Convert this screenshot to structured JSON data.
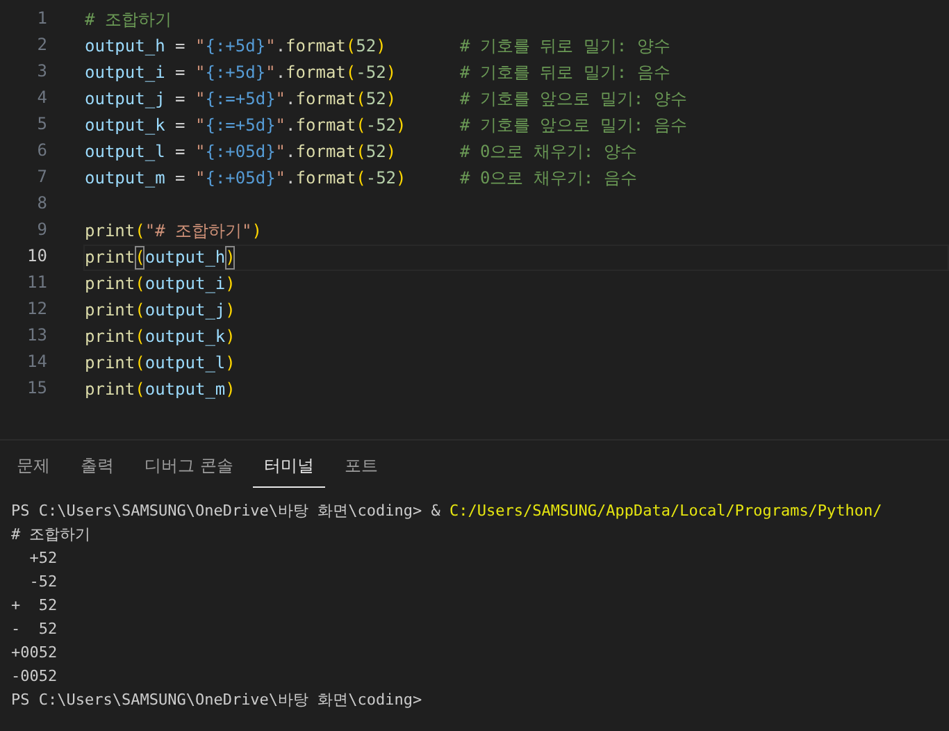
{
  "editor": {
    "lines": [
      {
        "number": "1",
        "current": false,
        "tokens": [
          {
            "kind": "comment",
            "text": "# 조합하기"
          }
        ]
      },
      {
        "number": "2",
        "current": false,
        "tokens": [
          {
            "kind": "var",
            "text": "output_h"
          },
          {
            "kind": "op",
            "text": " = "
          },
          {
            "kind": "str",
            "text": "\""
          },
          {
            "kind": "spec",
            "text": "{:+5d}"
          },
          {
            "kind": "str",
            "text": "\""
          },
          {
            "kind": "op",
            "text": "."
          },
          {
            "kind": "func",
            "text": "format"
          },
          {
            "kind": "paren",
            "text": "("
          },
          {
            "kind": "num",
            "text": "52"
          },
          {
            "kind": "paren",
            "text": ")"
          }
        ],
        "comment": "# 기호를 뒤로 밀기: 양수"
      },
      {
        "number": "3",
        "current": false,
        "tokens": [
          {
            "kind": "var",
            "text": "output_i"
          },
          {
            "kind": "op",
            "text": " = "
          },
          {
            "kind": "str",
            "text": "\""
          },
          {
            "kind": "spec",
            "text": "{:+5d}"
          },
          {
            "kind": "str",
            "text": "\""
          },
          {
            "kind": "op",
            "text": "."
          },
          {
            "kind": "func",
            "text": "format"
          },
          {
            "kind": "paren",
            "text": "("
          },
          {
            "kind": "num",
            "text": "-52"
          },
          {
            "kind": "paren",
            "text": ")"
          }
        ],
        "comment": "# 기호를 뒤로 밀기: 음수"
      },
      {
        "number": "4",
        "current": false,
        "tokens": [
          {
            "kind": "var",
            "text": "output_j"
          },
          {
            "kind": "op",
            "text": " = "
          },
          {
            "kind": "str",
            "text": "\""
          },
          {
            "kind": "spec",
            "text": "{:=+5d}"
          },
          {
            "kind": "str",
            "text": "\""
          },
          {
            "kind": "op",
            "text": "."
          },
          {
            "kind": "func",
            "text": "format"
          },
          {
            "kind": "paren",
            "text": "("
          },
          {
            "kind": "num",
            "text": "52"
          },
          {
            "kind": "paren",
            "text": ")"
          }
        ],
        "comment": "# 기호를 앞으로 밀기: 양수"
      },
      {
        "number": "5",
        "current": false,
        "tokens": [
          {
            "kind": "var",
            "text": "output_k"
          },
          {
            "kind": "op",
            "text": " = "
          },
          {
            "kind": "str",
            "text": "\""
          },
          {
            "kind": "spec",
            "text": "{:=+5d}"
          },
          {
            "kind": "str",
            "text": "\""
          },
          {
            "kind": "op",
            "text": "."
          },
          {
            "kind": "func",
            "text": "format"
          },
          {
            "kind": "paren",
            "text": "("
          },
          {
            "kind": "num",
            "text": "-52"
          },
          {
            "kind": "paren",
            "text": ")"
          }
        ],
        "comment": "# 기호를 앞으로 밀기: 음수"
      },
      {
        "number": "6",
        "current": false,
        "tokens": [
          {
            "kind": "var",
            "text": "output_l"
          },
          {
            "kind": "op",
            "text": " = "
          },
          {
            "kind": "str",
            "text": "\""
          },
          {
            "kind": "spec",
            "text": "{:+05d}"
          },
          {
            "kind": "str",
            "text": "\""
          },
          {
            "kind": "op",
            "text": "."
          },
          {
            "kind": "func",
            "text": "format"
          },
          {
            "kind": "paren",
            "text": "("
          },
          {
            "kind": "num",
            "text": "52"
          },
          {
            "kind": "paren",
            "text": ")"
          }
        ],
        "comment": "# 0으로 채우기: 양수"
      },
      {
        "number": "7",
        "current": false,
        "tokens": [
          {
            "kind": "var",
            "text": "output_m"
          },
          {
            "kind": "op",
            "text": " = "
          },
          {
            "kind": "str",
            "text": "\""
          },
          {
            "kind": "spec",
            "text": "{:+05d}"
          },
          {
            "kind": "str",
            "text": "\""
          },
          {
            "kind": "op",
            "text": "."
          },
          {
            "kind": "func",
            "text": "format"
          },
          {
            "kind": "paren",
            "text": "("
          },
          {
            "kind": "num",
            "text": "-52"
          },
          {
            "kind": "paren",
            "text": ")"
          }
        ],
        "comment": "# 0으로 채우기: 음수"
      },
      {
        "number": "8",
        "current": false
      },
      {
        "number": "9",
        "current": false,
        "tokens": [
          {
            "kind": "func",
            "text": "print"
          },
          {
            "kind": "paren",
            "text": "("
          },
          {
            "kind": "str",
            "text": "\"# 조합하기\""
          },
          {
            "kind": "paren",
            "text": ")"
          }
        ]
      },
      {
        "number": "10",
        "current": true,
        "tokens": [
          {
            "kind": "func",
            "text": "print"
          },
          {
            "kind": "match",
            "text": "("
          },
          {
            "kind": "var",
            "text": "output_h"
          },
          {
            "kind": "match",
            "text": ")"
          }
        ]
      },
      {
        "number": "11",
        "current": false,
        "tokens": [
          {
            "kind": "func",
            "text": "print"
          },
          {
            "kind": "paren",
            "text": "("
          },
          {
            "kind": "var",
            "text": "output_i"
          },
          {
            "kind": "paren",
            "text": ")"
          }
        ]
      },
      {
        "number": "12",
        "current": false,
        "tokens": [
          {
            "kind": "func",
            "text": "print"
          },
          {
            "kind": "paren",
            "text": "("
          },
          {
            "kind": "var",
            "text": "output_j"
          },
          {
            "kind": "paren",
            "text": ")"
          }
        ]
      },
      {
        "number": "13",
        "current": false,
        "tokens": [
          {
            "kind": "func",
            "text": "print"
          },
          {
            "kind": "paren",
            "text": "("
          },
          {
            "kind": "var",
            "text": "output_k"
          },
          {
            "kind": "paren",
            "text": ")"
          }
        ]
      },
      {
        "number": "14",
        "current": false,
        "tokens": [
          {
            "kind": "func",
            "text": "print"
          },
          {
            "kind": "paren",
            "text": "("
          },
          {
            "kind": "var",
            "text": "output_l"
          },
          {
            "kind": "paren",
            "text": ")"
          }
        ]
      },
      {
        "number": "15",
        "current": false,
        "tokens": [
          {
            "kind": "func",
            "text": "print"
          },
          {
            "kind": "paren",
            "text": "("
          },
          {
            "kind": "var",
            "text": "output_m"
          },
          {
            "kind": "paren",
            "text": ")"
          }
        ]
      }
    ]
  },
  "panel": {
    "tabs": [
      {
        "label": "문제",
        "selected": false
      },
      {
        "label": "출력",
        "selected": false
      },
      {
        "label": "디버그 콘솔",
        "selected": false
      },
      {
        "label": "터미널",
        "selected": true
      },
      {
        "label": "포트",
        "selected": false
      }
    ],
    "terminal": [
      [
        {
          "kind": "plain",
          "text": "PS C:\\Users\\SAMSUNG\\OneDrive\\바탕 화면\\coding> & "
        },
        {
          "kind": "path",
          "text": "C:/Users/SAMSUNG/AppData/Local/Programs/Python/"
        }
      ],
      [
        {
          "kind": "plain",
          "text": "# 조합하기"
        }
      ],
      [
        {
          "kind": "plain",
          "text": "  +52"
        }
      ],
      [
        {
          "kind": "plain",
          "text": "  -52"
        }
      ],
      [
        {
          "kind": "plain",
          "text": "+  52"
        }
      ],
      [
        {
          "kind": "plain",
          "text": "-  52"
        }
      ],
      [
        {
          "kind": "plain",
          "text": "+0052"
        }
      ],
      [
        {
          "kind": "plain",
          "text": "-0052"
        }
      ],
      [
        {
          "kind": "plain",
          "text": "PS C:\\Users\\SAMSUNG\\OneDrive\\바탕 화면\\coding>"
        }
      ]
    ]
  }
}
